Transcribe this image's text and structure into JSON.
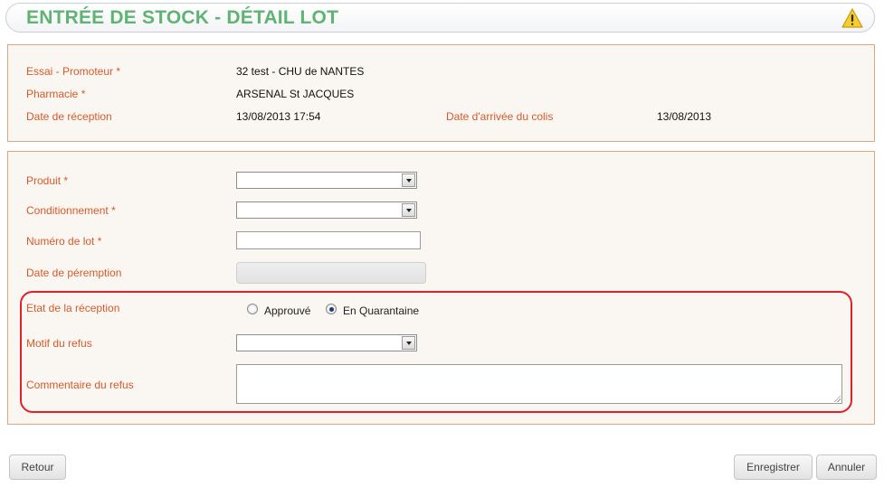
{
  "header": {
    "title": "ENTRÉE DE STOCK - DÉTAIL LOT",
    "warning_icon": "warning-icon"
  },
  "info": {
    "essai_label": "Essai - Promoteur *",
    "essai_value": "32 test - CHU de NANTES",
    "pharmacie_label": "Pharmacie *",
    "pharmacie_value": "ARSENAL St JACQUES",
    "date_reception_label": "Date de réception",
    "date_reception_value": "13/08/2013 17:54",
    "date_arrivee_label": "Date d'arrivée du colis",
    "date_arrivee_value": "13/08/2013"
  },
  "form": {
    "produit_label": "Produit *",
    "produit_value": "",
    "conditionnement_label": "Conditionnement *",
    "conditionnement_value": "",
    "numero_lot_label": "Numéro de lot *",
    "numero_lot_value": "",
    "date_peremption_label": "Date de péremption",
    "etat_label": "Etat de la réception",
    "etat_options": [
      "Approuvé",
      "En Quarantaine"
    ],
    "etat_selected": "En Quarantaine",
    "motif_label": "Motif du refus",
    "motif_value": "",
    "commentaire_label": "Commentaire du refus",
    "commentaire_value": ""
  },
  "buttons": {
    "retour": "Retour",
    "enregistrer": "Enregistrer",
    "annuler": "Annuler"
  },
  "colors": {
    "title": "#5fb373",
    "label": "#d55a2c",
    "panel_border": "#d9a87c",
    "highlight": "#e0202a"
  }
}
